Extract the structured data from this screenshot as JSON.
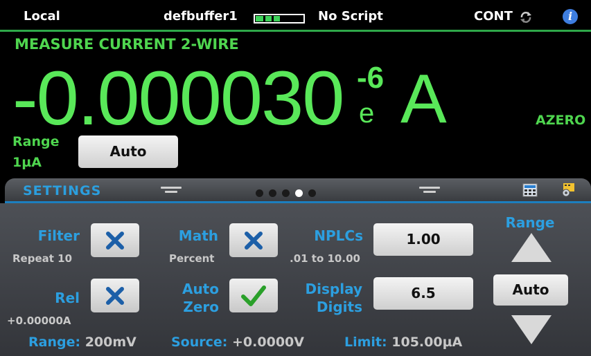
{
  "status": {
    "mode": "Local",
    "buffer": "defbuffer1",
    "buffer_fill_fraction": 0.5,
    "script": "No Script",
    "trigger": "CONT",
    "icons": [
      "refresh-icon",
      "info-icon"
    ],
    "info_glyph": "i"
  },
  "measure": {
    "title": "MEASURE CURRENT 2-WIRE",
    "reading": "-0.000030",
    "exponent_base": "e",
    "exponent": "-6",
    "unit": "A",
    "azero": "AZERO",
    "range_label": "Range",
    "range_value": "1µA",
    "range_button": "Auto"
  },
  "settings": {
    "title": "SETTINGS",
    "page_count": 5,
    "active_page": 4,
    "filter": {
      "label": "Filter",
      "sub": "Repeat 10",
      "state": "off"
    },
    "math": {
      "label": "Math",
      "sub": "Percent",
      "state": "off"
    },
    "nplcs": {
      "label": "NPLCs",
      "sub": ".01 to 10.00",
      "value": "1.00"
    },
    "rel": {
      "label": "Rel",
      "sub": "+0.00000A",
      "state": "off"
    },
    "autozero": {
      "label_line1": "Auto",
      "label_line2": "Zero",
      "state": "on"
    },
    "display_digits": {
      "label_line1": "Display",
      "label_line2": "Digits",
      "value": "6.5"
    },
    "range": {
      "label": "Range",
      "button": "Auto"
    }
  },
  "footer": {
    "range_key": "Range:",
    "range_val": "200mV",
    "source_key": "Source:",
    "source_val": "+0.0000V",
    "limit_key": "Limit:",
    "limit_val": "105.00µA"
  },
  "colors": {
    "reading": "#59e859",
    "label_blue": "#2c9fe0",
    "status_line": "#2fa84a"
  }
}
